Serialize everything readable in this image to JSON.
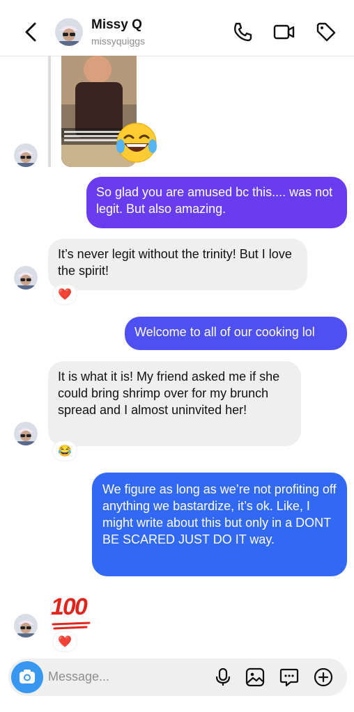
{
  "header": {
    "name": "Missy Q",
    "username": "missyquiggs"
  },
  "messages": [
    {
      "text": "So glad you are amused bc this.... was not legit. But also amazing."
    },
    {
      "text": "It’s never legit without the trinity! But I love the spirit!",
      "reaction": "❤️"
    },
    {
      "text": "Welcome to all of our cooking lol"
    },
    {
      "text": "It is what it is! My friend asked me if she could bring shrimp over for my brunch spread and I almost uninvited her!",
      "reaction": "😂"
    },
    {
      "text": "We figure as long as we’re not profiting off anything we bastardize, it’s ok. Like, I might write about this but only in a DONT BE SCARED JUST DO IT way."
    },
    {
      "text": "100",
      "reaction": "❤️"
    }
  ],
  "composer": {
    "placeholder": "Message..."
  },
  "colors": {
    "outgoing_top": "#6a3cf0",
    "outgoing_bottom": "#2f6df6",
    "incoming": "#efefef",
    "camera": "#3897f0"
  }
}
